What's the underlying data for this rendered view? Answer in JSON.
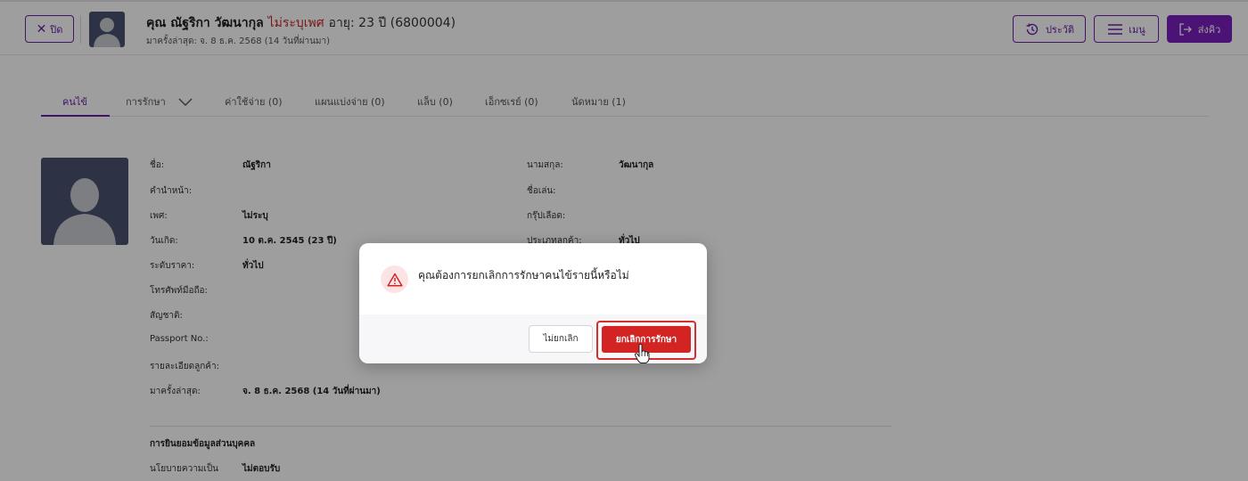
{
  "header": {
    "close_label": "ปิด",
    "name_prefix": "คุณ ณัฐริกา วัฒนากุล",
    "gender": "ไม่ระบุเพศ",
    "age_id": "อายุ: 23 ปี  (6800004)",
    "last_visit": "มาครั้งล่าสุด: จ. 8 ธ.ค. 2568 (14 วันที่ผ่านมา)",
    "history_label": "ประวัติ",
    "menu_label": "เมนู",
    "send_label": "ส่งคิว"
  },
  "tabs": [
    {
      "label": "คนไข้"
    },
    {
      "label": "การรักษา"
    },
    {
      "label": "ค่าใช้จ่าย (0)"
    },
    {
      "label": "แผนแบ่งจ่าย (0)"
    },
    {
      "label": "แล็บ (0)"
    },
    {
      "label": "เอ็กซเรย์ (0)"
    },
    {
      "label": "นัดหมาย (1)"
    }
  ],
  "patient": {
    "first_name_label": "ชื่อ:",
    "first_name": "ณัฐริกา",
    "last_name_label": "นามสกุล:",
    "last_name": "วัฒนากุล",
    "title_label": "คำนำหน้า:",
    "nickname_label": "ชื่อเล่น:",
    "gender_label": "เพศ:",
    "gender": "ไม่ระบุ",
    "blood_label": "กรุ๊ปเลือด:",
    "birth_label": "วันเกิด:",
    "birth": "10 ต.ค. 2545 (23 ปี)",
    "customer_type_label": "ประเภทลูกค้า:",
    "customer_type": "ทั่วไป",
    "price_level_label": "ระดับราคา:",
    "price_level": "ทั่วไป",
    "mobile_label": "โทรศัพท์มือถือ:",
    "nationality_label": "สัญชาติ:",
    "passport_label": "Passport No.:",
    "details_label": "รายละเอียดลูกค้า:",
    "last_visit_label": "มาครั้งล่าสุด:",
    "last_visit": "จ. 8 ธ.ค. 2568 (14 วันที่ผ่านมา)"
  },
  "consent": {
    "title": "การยินยอมข้อมูลส่วนบุคคล",
    "policy_label": "นโยบายความเป็น",
    "policy_value": "ไม่ตอบรับ"
  },
  "dialog": {
    "message": "คุณต้องการยกเลิกการรักษาคนไข้รายนี้หรือไม่",
    "cancel_label": "ไม่ยกเลิก",
    "confirm_label": "ยกเลิกการรักษา"
  },
  "colors": {
    "accent": "#6b1fa8",
    "danger": "#d32424",
    "overlay": "rgba(0,0,0,0.38)"
  }
}
